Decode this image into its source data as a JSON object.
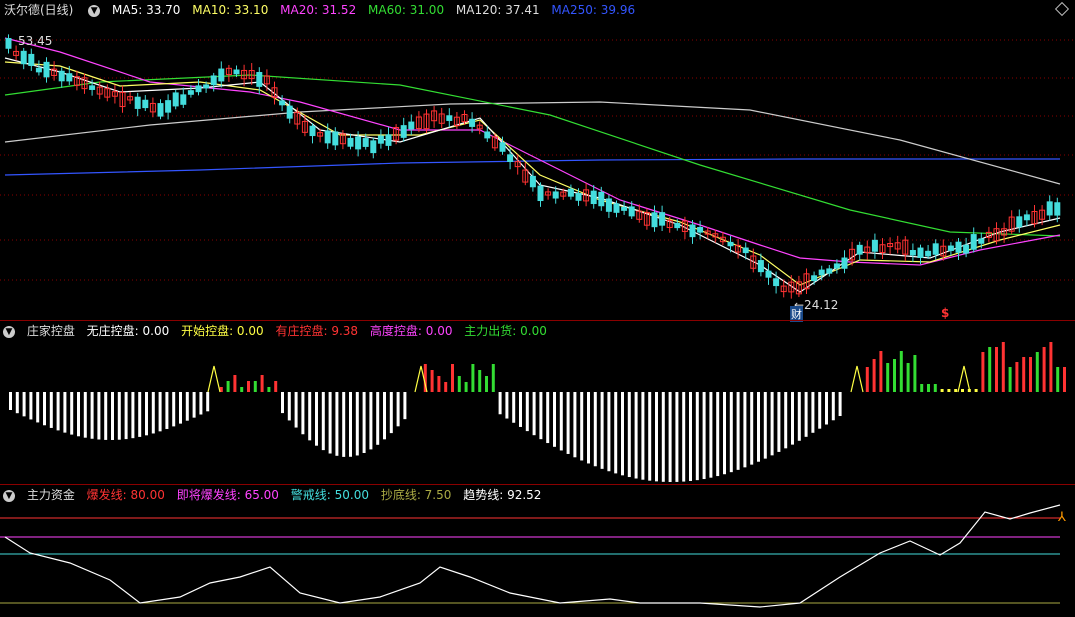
{
  "price_panel": {
    "title": "沃尔德(日线)",
    "indicators": [
      {
        "label": "MA5: 33.70",
        "color": "#ffffff"
      },
      {
        "label": "MA10: 33.10",
        "color": "#ffff66"
      },
      {
        "label": "MA20: 31.52",
        "color": "#ff44ff"
      },
      {
        "label": "MA60: 31.00",
        "color": "#33dd33"
      },
      {
        "label": "MA120: 37.41",
        "color": "#dddddd"
      },
      {
        "label": "MA250: 39.96",
        "color": "#3355ff"
      }
    ],
    "high_label": "53.45",
    "low_label": "←24.12",
    "marker_cai": "财",
    "marker_s": "$"
  },
  "control_panel": {
    "title": "庄家控盘",
    "indicators": [
      {
        "label": "无庄控盘: 0.00",
        "color": "#ffffff"
      },
      {
        "label": "开始控盘: 0.00",
        "color": "#ffff44"
      },
      {
        "label": "有庄控盘: 9.38",
        "color": "#ff3333"
      },
      {
        "label": "高度控盘: 0.00",
        "color": "#ff44ff"
      },
      {
        "label": "主力出货: 0.00",
        "color": "#33dd33"
      }
    ]
  },
  "fund_panel": {
    "title": "主力资金",
    "indicators": [
      {
        "label": "爆发线: 80.00",
        "color": "#ff3333"
      },
      {
        "label": "即将爆发线: 65.00",
        "color": "#ff44ff"
      },
      {
        "label": "警戒线: 50.00",
        "color": "#44dddd"
      },
      {
        "label": "抄底线: 7.50",
        "color": "#aaaa44"
      },
      {
        "label": "趋势线: 92.52",
        "color": "#ffffff"
      }
    ]
  },
  "colors": {
    "up": "#ff3333",
    "down": "#44dddd",
    "grid": "#8a0000",
    "bg": "#000000"
  }
}
